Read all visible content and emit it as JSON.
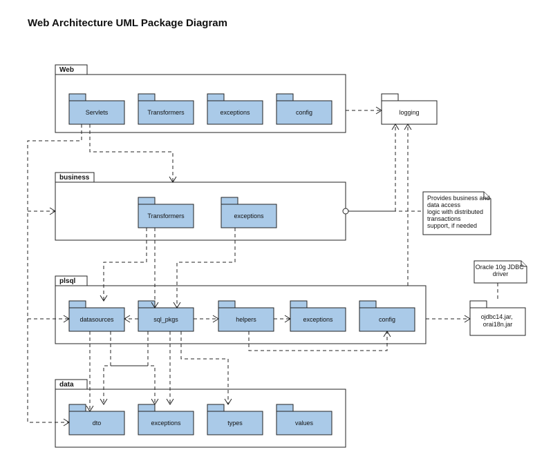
{
  "title": "Web Architecture UML Package Diagram",
  "containers": {
    "web": "Web",
    "business": "business",
    "plsql": "plsql",
    "data": "data"
  },
  "packages": {
    "web_servlets": "Servlets",
    "web_transformers": "Transformers",
    "web_exceptions": "exceptions",
    "web_config": "config",
    "logging": "logging",
    "biz_transformers": "Transformers",
    "biz_exceptions": "exceptions",
    "pl_datasources": "datasources",
    "pl_sqlpkgs": "sql_pkgs",
    "pl_helpers": "helpers",
    "pl_exceptions": "exceptions",
    "pl_config": "config",
    "jdbc_jars": "ojdbc14.jar, orai18n.jar",
    "d_dto": "dto",
    "d_exceptions": "exceptions",
    "d_types": "types",
    "d_values": "values"
  },
  "notes": {
    "biz_note": "Provides business and data access logic with distributed transactions support, if needed",
    "jdbc_note": "Oracle 10g JDBC driver"
  },
  "chart_data": {
    "type": "diagram",
    "diagram_kind": "uml_package",
    "title": "Web Architecture UML Package Diagram",
    "containers": [
      {
        "id": "web",
        "label": "Web",
        "children": [
          "web_servlets",
          "web_transformers",
          "web_exceptions",
          "web_config"
        ]
      },
      {
        "id": "business",
        "label": "business",
        "children": [
          "biz_transformers",
          "biz_exceptions"
        ]
      },
      {
        "id": "plsql",
        "label": "plsql",
        "children": [
          "pl_datasources",
          "pl_sqlpkgs",
          "pl_helpers",
          "pl_exceptions",
          "pl_config"
        ]
      },
      {
        "id": "data",
        "label": "data",
        "children": [
          "d_dto",
          "d_exceptions",
          "d_types",
          "d_values"
        ]
      }
    ],
    "standalone_packages": [
      {
        "id": "logging",
        "label": "logging"
      },
      {
        "id": "jdbc_jars",
        "label": "ojdbc14.jar, orai18n.jar"
      }
    ],
    "notes": [
      {
        "id": "biz_note",
        "text": "Provides business and data access logic with distributed transactions support, if needed",
        "attached_to": "business"
      },
      {
        "id": "jdbc_note",
        "text": "Oracle 10g JDBC driver",
        "attached_to": "jdbc_jars"
      }
    ],
    "dependencies": [
      {
        "from": "web_servlets",
        "to": "business"
      },
      {
        "from": "web_servlets",
        "to": "d_dto",
        "via": "left-rail"
      },
      {
        "from": "web_servlets",
        "to": "d_exceptions",
        "via": "left-rail"
      },
      {
        "from": "web_servlets",
        "to": "pl_datasources",
        "via": "left-rail"
      },
      {
        "from": "web",
        "to": "logging"
      },
      {
        "from": "business",
        "to": "logging"
      },
      {
        "from": "plsql",
        "to": "logging"
      },
      {
        "from": "biz_transformers",
        "to": "pl_sqlpkgs"
      },
      {
        "from": "biz_transformers",
        "to": "pl_datasources"
      },
      {
        "from": "biz_exceptions",
        "to": "pl_sqlpkgs"
      },
      {
        "from": "pl_sqlpkgs",
        "to": "pl_datasources"
      },
      {
        "from": "pl_sqlpkgs",
        "to": "pl_helpers"
      },
      {
        "from": "pl_helpers",
        "to": "pl_exceptions"
      },
      {
        "from": "pl_config",
        "to": "jdbc_jars"
      },
      {
        "from": "pl_datasources",
        "to": "d_dto"
      },
      {
        "from": "pl_datasources",
        "to": "d_exceptions"
      },
      {
        "from": "pl_sqlpkgs",
        "to": "d_dto"
      },
      {
        "from": "pl_sqlpkgs",
        "to": "d_exceptions"
      },
      {
        "from": "pl_sqlpkgs",
        "to": "d_types"
      },
      {
        "from": "pl_helpers",
        "to": "pl_config"
      },
      {
        "from": "biz_note",
        "to": "business",
        "kind": "note-anchor"
      },
      {
        "from": "jdbc_note",
        "to": "jdbc_jars",
        "kind": "note-anchor"
      }
    ]
  }
}
